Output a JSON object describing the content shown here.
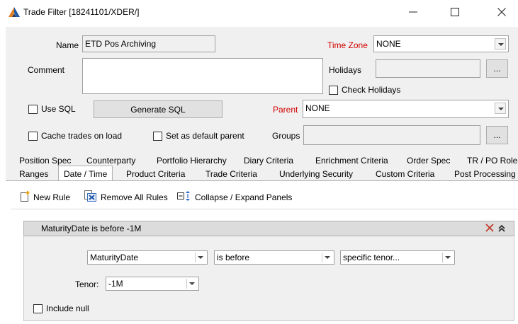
{
  "window": {
    "title": "Trade Filter [18241101/XDER/]",
    "minimize": "—",
    "maximize": "☐",
    "close": "✕"
  },
  "form": {
    "name_label": "Name",
    "name_value": "ETD Pos Archiving",
    "timezone_label": "Time Zone",
    "timezone_value": "NONE",
    "comment_label": "Comment",
    "comment_value": "",
    "holidays_label": "Holidays",
    "holidays_value": "",
    "holidays_btn": "...",
    "check_holidays_label": "Check Holidays",
    "use_sql_label": "Use SQL",
    "generate_sql_label": "Generate SQL",
    "parent_label": "Parent",
    "parent_value": "NONE",
    "cache_trades_label": "Cache trades on load",
    "default_parent_label": "Set as default parent",
    "groups_label": "Groups",
    "groups_value": "",
    "groups_btn": "..."
  },
  "tabs_row1": [
    "Position Spec",
    "Counterparty",
    "Portfolio Hierarchy",
    "Diary Criteria",
    "Enrichment Criteria",
    "Order Spec",
    "TR / PO Role"
  ],
  "tabs_row2": [
    "Ranges",
    "Date / Time",
    "Product Criteria",
    "Trade Criteria",
    "Underlying Security",
    "Custom Criteria",
    "Post Processing"
  ],
  "toolbar": {
    "new_rule": "New Rule",
    "remove_all": "Remove All Rules",
    "collapse": "Collapse / Expand Panels"
  },
  "rule": {
    "header": "MaturityDate is before -1M",
    "field": "MaturityDate",
    "operator": "is before",
    "mode": "specific tenor...",
    "tenor_label": "Tenor:",
    "tenor_value": "-1M",
    "include_null_label": "Include null"
  },
  "colors": {
    "required_label": "#d00000",
    "remove_icon": "#c0392b"
  }
}
